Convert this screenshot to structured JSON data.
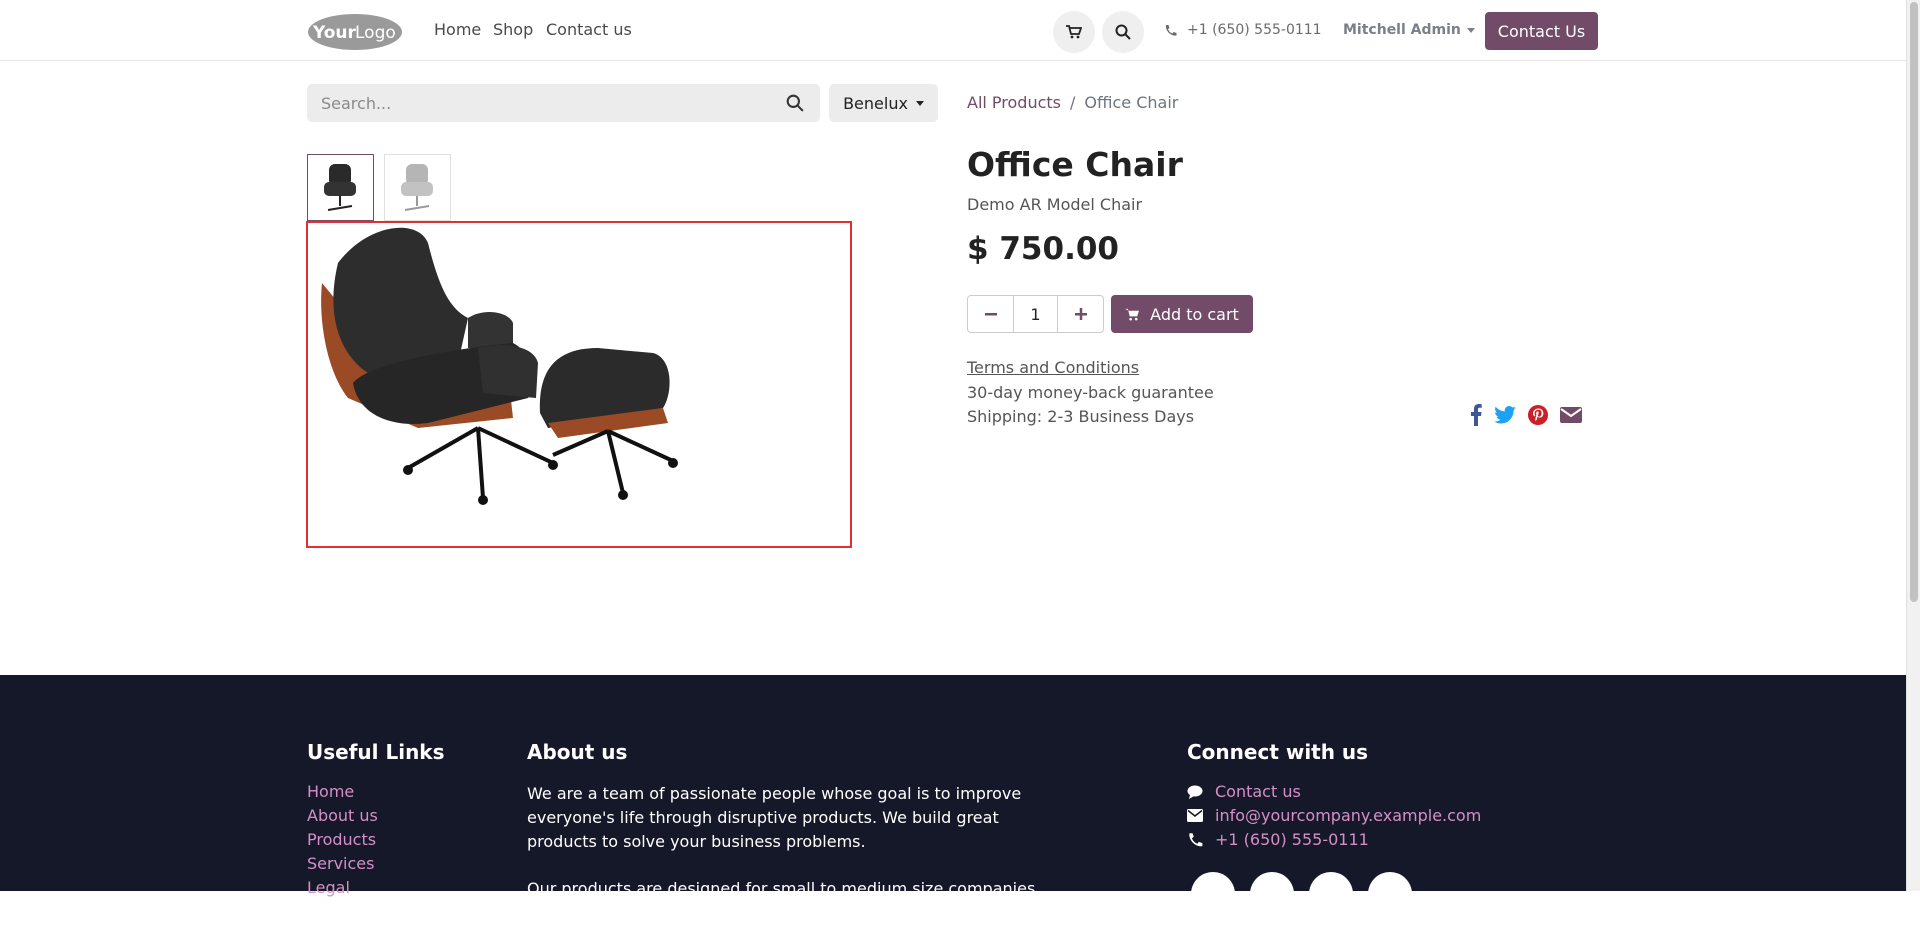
{
  "header": {
    "logo_alt": "YourLogo",
    "nav": [
      {
        "label": "Home"
      },
      {
        "label": "Shop"
      },
      {
        "label": "Contact us"
      }
    ],
    "phone": "+1 (650) 555-0111",
    "user": "Mitchell Admin",
    "contact_button": "Contact Us"
  },
  "search": {
    "placeholder": "Search...",
    "value": ""
  },
  "pricelist": {
    "selected": "Benelux"
  },
  "breadcrumb": {
    "parent": "All Products",
    "separator": "/",
    "current": "Office Chair"
  },
  "product": {
    "name": "Office Chair",
    "description": "Demo AR Model Chair",
    "price": "$ 750.00",
    "quantity": "1",
    "add_to_cart": "Add to cart",
    "terms": "Terms and Conditions",
    "guarantee": "30-day money-back guarantee",
    "shipping": "Shipping: 2-3 Business Days"
  },
  "footer": {
    "useful_links": {
      "title": "Useful Links",
      "items": [
        "Home",
        "About us",
        "Products",
        "Services",
        "Legal"
      ]
    },
    "about": {
      "title": "About us",
      "text": "We are a team of passionate people whose goal is to improve everyone's life through disruptive products. We build great products to solve your business problems.",
      "text2": "Our products are designed for small to medium size companies willing"
    },
    "connect": {
      "title": "Connect with us",
      "contact": "Contact us",
      "email": "info@yourcompany.example.com",
      "phone": "+1 (650) 555-0111"
    }
  },
  "colors": {
    "brand": "#714b67",
    "footer_bg": "#151829",
    "footer_link": "#d68fc6"
  }
}
